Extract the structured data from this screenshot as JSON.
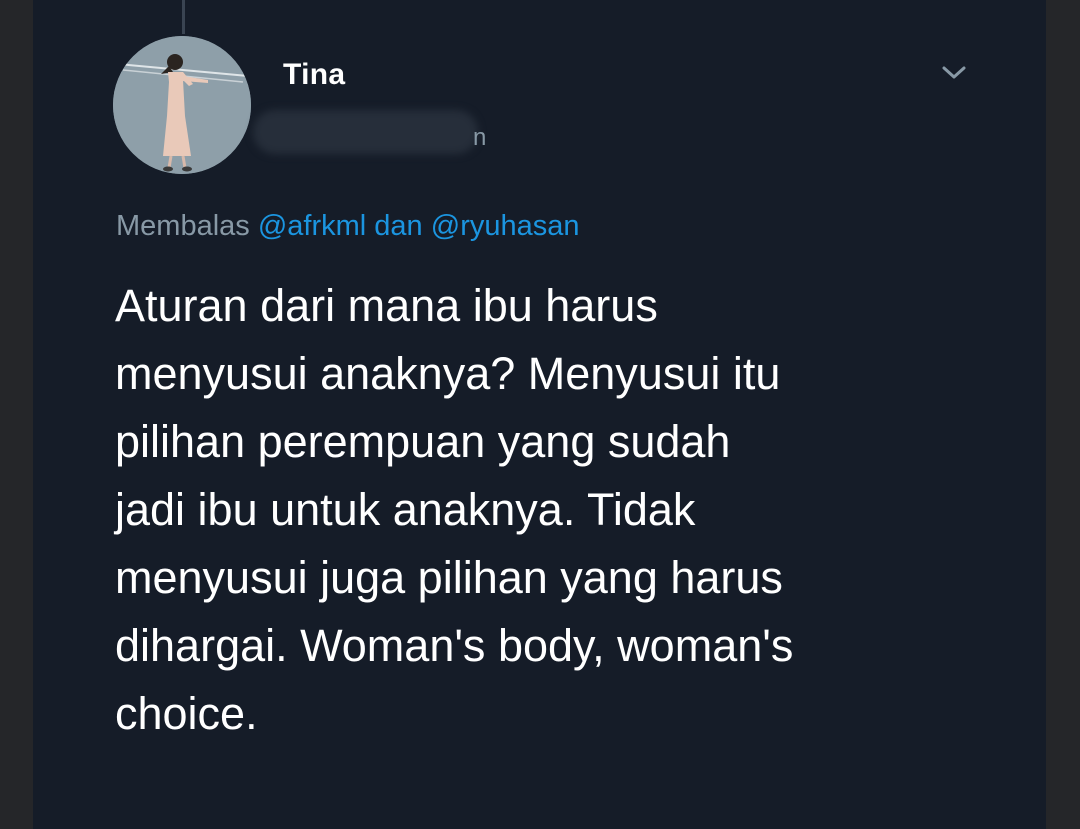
{
  "tweet": {
    "author_name": "Tina",
    "author_handle_tail": "n",
    "reply_prefix": "Membalas",
    "reply_mention_1": "@afrkml",
    "reply_joiner": "dan",
    "reply_mention_2": "@ryuhasan",
    "text": "Aturan dari mana ibu harus\nmenyusui anaknya? Menyusui itu\npilihan perempuan yang sudah\njadi ibu untuk anaknya. Tidak\nmenyusui juga pilihan yang harus\ndihargai. Woman's body, woman's\nchoice."
  },
  "icons": {
    "menu": "chevron-down-icon",
    "avatar": "profile-photo"
  },
  "colors": {
    "background": "#151c28",
    "text": "#ffffff",
    "muted": "#8899a6",
    "mention": "#1b95e0"
  }
}
